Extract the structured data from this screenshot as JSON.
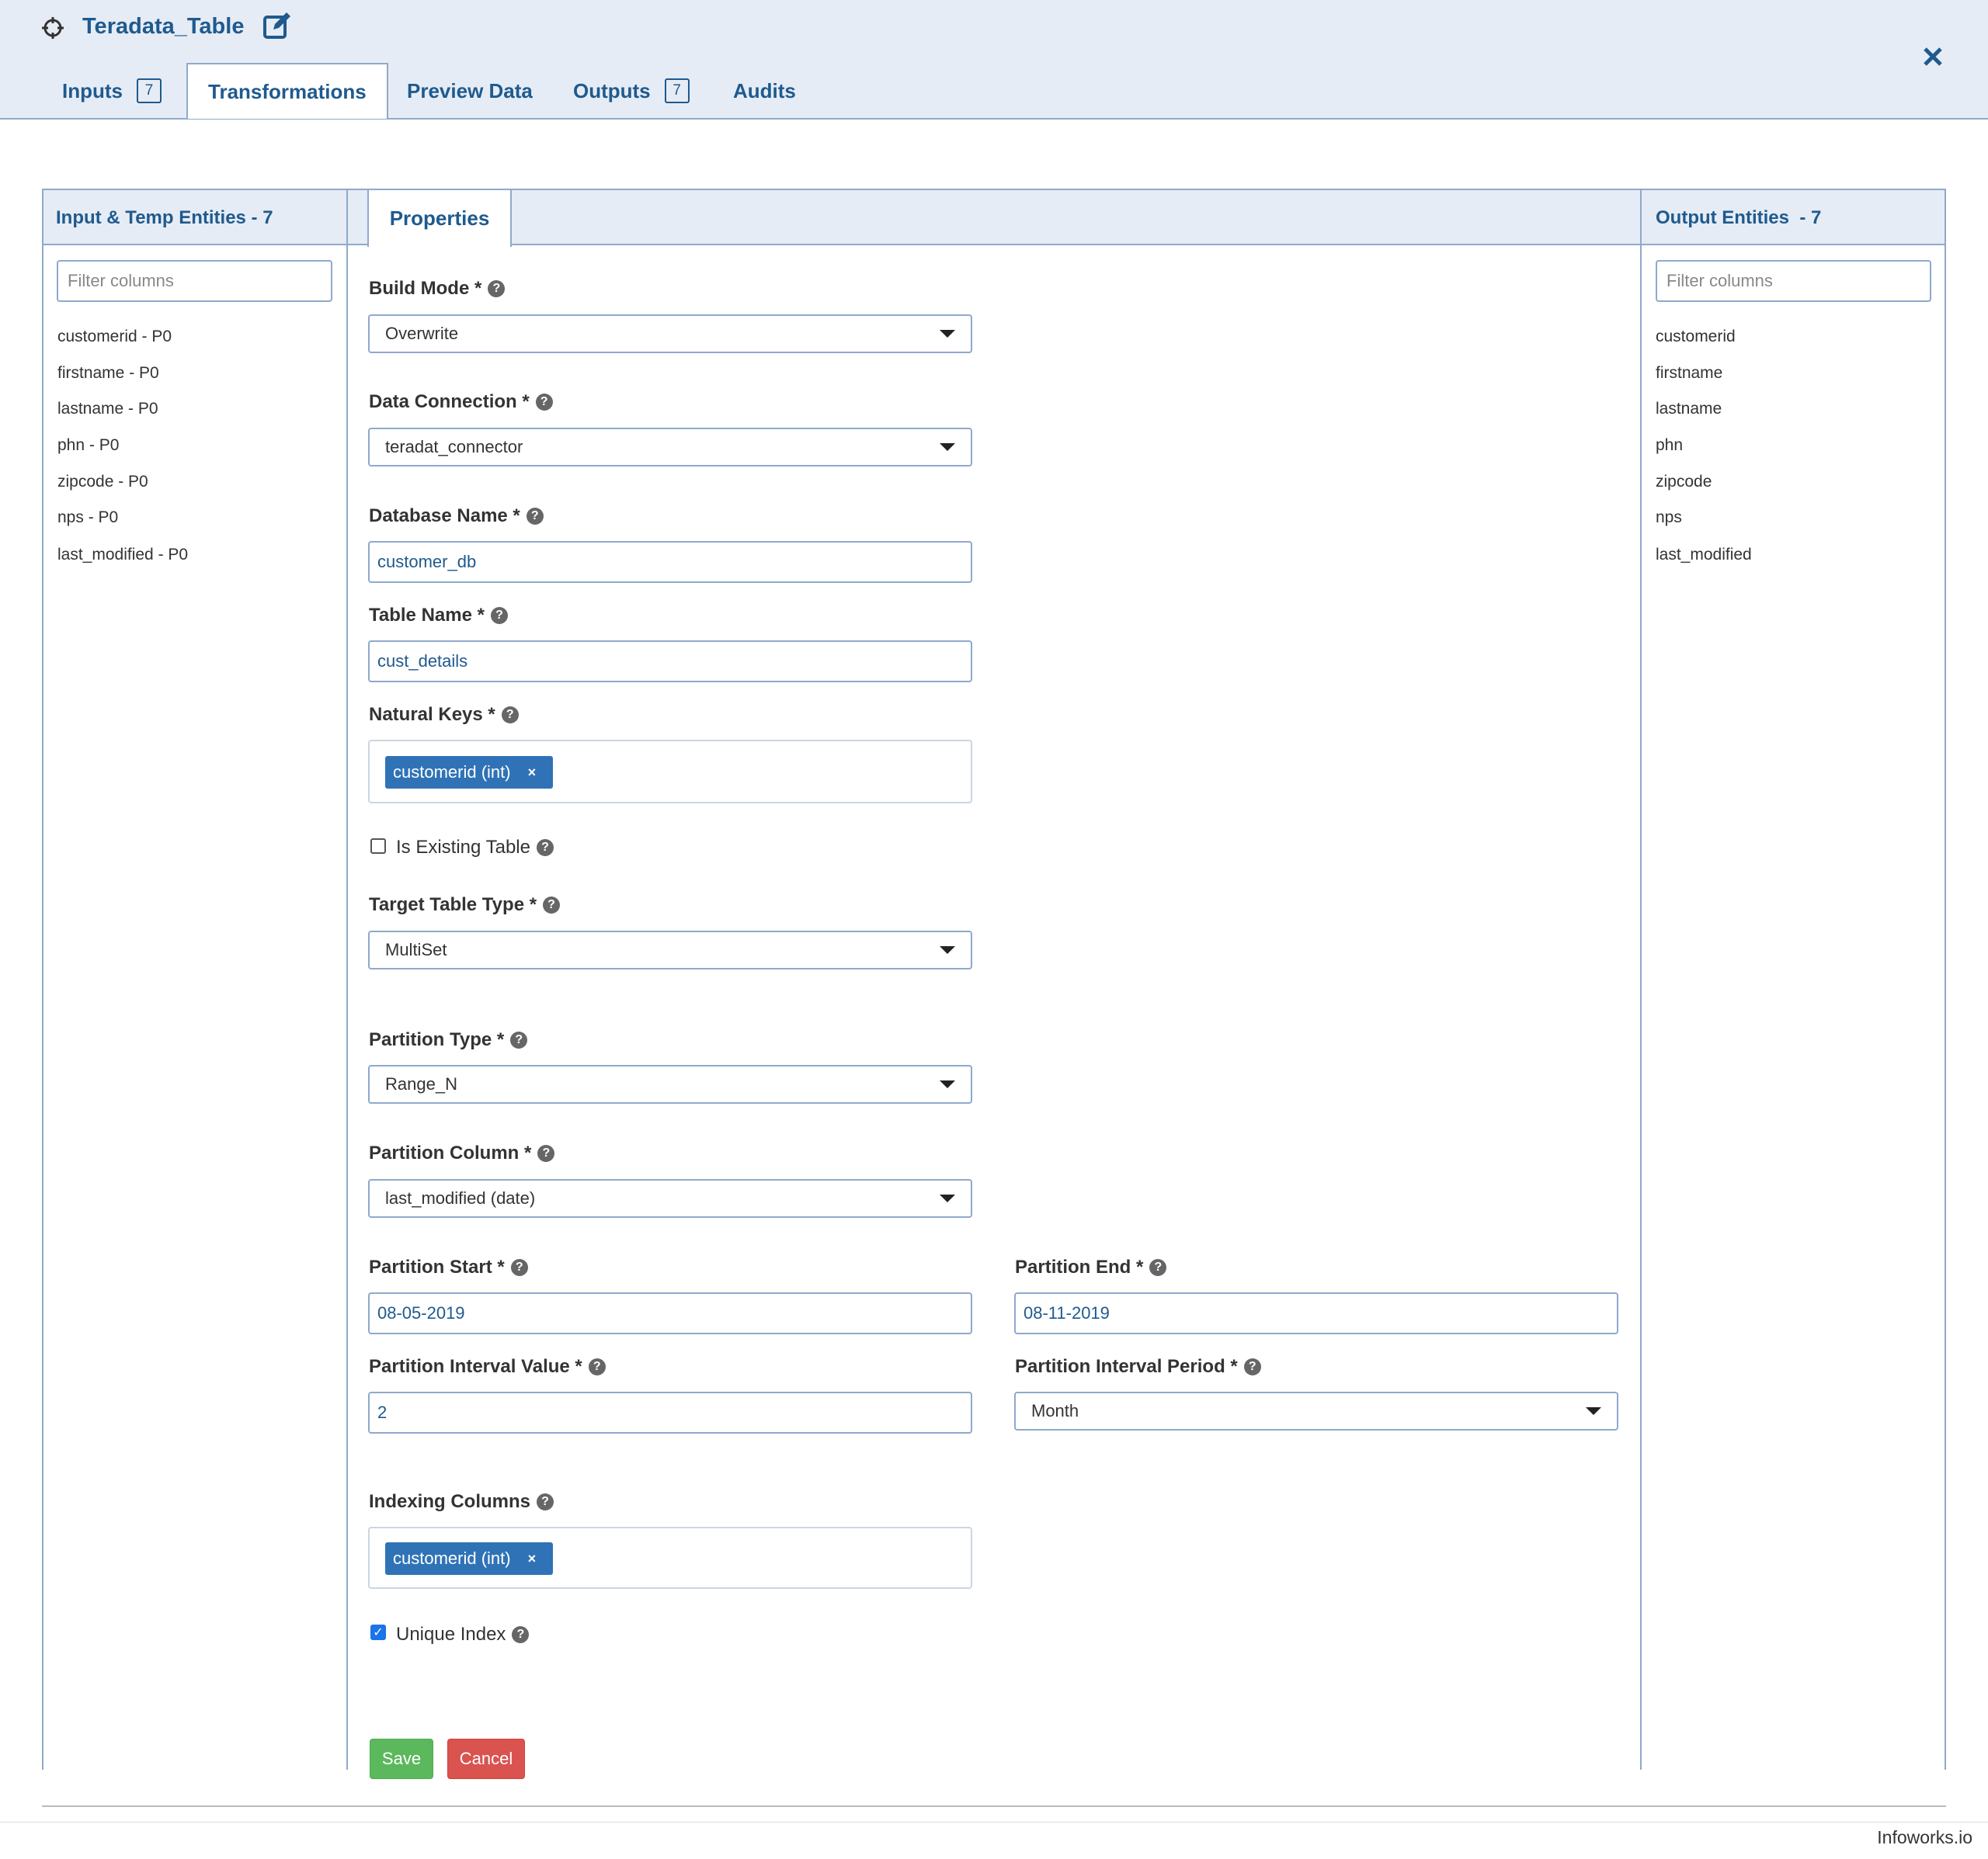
{
  "header": {
    "title": "Teradata_Table",
    "tabs": [
      {
        "label": "Inputs",
        "badge": "7"
      },
      {
        "label": "Transformations"
      },
      {
        "label": "Preview Data"
      },
      {
        "label": "Outputs",
        "badge": "7"
      },
      {
        "label": "Audits"
      }
    ],
    "active_tab": "Transformations",
    "icons": [
      "crosshair-icon",
      "edit-icon",
      "close-icon"
    ]
  },
  "left_panel": {
    "title": "Input & Temp Entities - 7",
    "filter_placeholder": "Filter columns",
    "items": [
      "customerid - P0",
      "firstname - P0",
      "lastname - P0",
      "phn - P0",
      "zipcode - P0",
      "nps - P0",
      "last_modified - P0"
    ]
  },
  "center_panel": {
    "tab": "Properties",
    "build_mode": {
      "label": "Build Mode *",
      "value": "Overwrite"
    },
    "data_connection": {
      "label": "Data Connection *",
      "value": "teradat_connector"
    },
    "database_name": {
      "label": "Database Name *",
      "value": "customer_db"
    },
    "table_name": {
      "label": "Table Name *",
      "value": "cust_details"
    },
    "natural_keys": {
      "label": "Natural Keys *",
      "tags": [
        "customerid (int)"
      ]
    },
    "is_existing_table": {
      "label": "Is Existing Table",
      "checked": false
    },
    "target_table_type": {
      "label": "Target Table Type *",
      "value": "MultiSet"
    },
    "partition_type": {
      "label": "Partition Type *",
      "value": "Range_N"
    },
    "partition_column": {
      "label": "Partition Column *",
      "value": "last_modified (date)"
    },
    "partition_start": {
      "label": "Partition Start *",
      "value": "08-05-2019"
    },
    "partition_end": {
      "label": "Partition End *",
      "value": "08-11-2019"
    },
    "partition_interval_value": {
      "label": "Partition Interval Value *",
      "value": "2"
    },
    "partition_interval_period": {
      "label": "Partition Interval Period *",
      "value": "Month"
    },
    "indexing_columns": {
      "label": "Indexing Columns",
      "tags": [
        "customerid (int)"
      ]
    },
    "unique_index": {
      "label": "Unique Index",
      "checked": true
    },
    "save_label": "Save",
    "cancel_label": "Cancel"
  },
  "right_panel": {
    "title": "Output Entities  - 7",
    "filter_placeholder": "Filter columns",
    "items": [
      "customerid",
      "firstname",
      "lastname",
      "phn",
      "zipcode",
      "nps",
      "last_modified"
    ]
  },
  "footer": {
    "brand": "Infoworks.io"
  },
  "colors": {
    "accent": "#1f5a8e",
    "tag": "#2f73b6",
    "save": "#5cb85c",
    "cancel": "#d9534f",
    "header_bg": "#e6ecf5"
  }
}
